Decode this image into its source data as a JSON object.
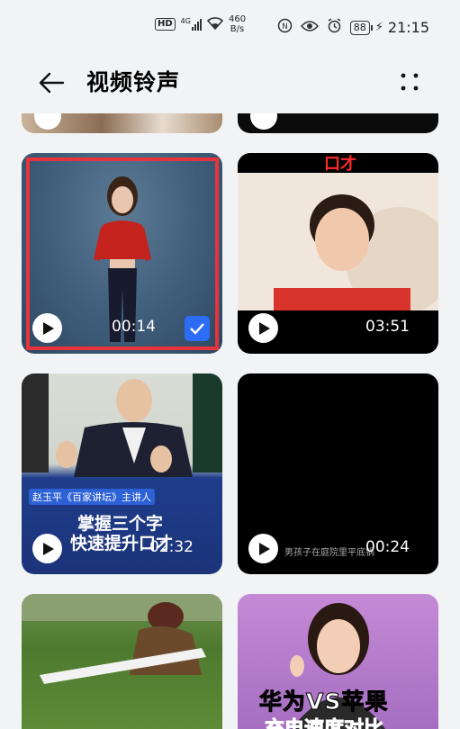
{
  "status_bar": {
    "hd": "HD",
    "network": "4G",
    "speed_value": "460",
    "speed_unit": "B/s",
    "battery": "88",
    "time": "21:15"
  },
  "header": {
    "title": "视频铃声"
  },
  "videos": [
    {
      "duration": "00:14",
      "selected": true
    },
    {
      "duration": "03:51",
      "caption": "口才"
    },
    {
      "duration": "02:32",
      "caption_tag": "赵玉平《百家讲坛》主讲人",
      "caption_line1": "掌握三个字",
      "caption_line2": "快速提升口才"
    },
    {
      "duration": "00:24",
      "caption": "男孩子在庭院里平底锅"
    },
    {
      "duration": "",
      "caption": ""
    },
    {
      "duration": "",
      "caption_line1": "华为VS苹果",
      "caption_line2": "充电速度对比"
    }
  ],
  "colors": {
    "accent_blue": "#2d6cf5",
    "selection_red": "#e8333a",
    "background": "#f1f3f5"
  }
}
